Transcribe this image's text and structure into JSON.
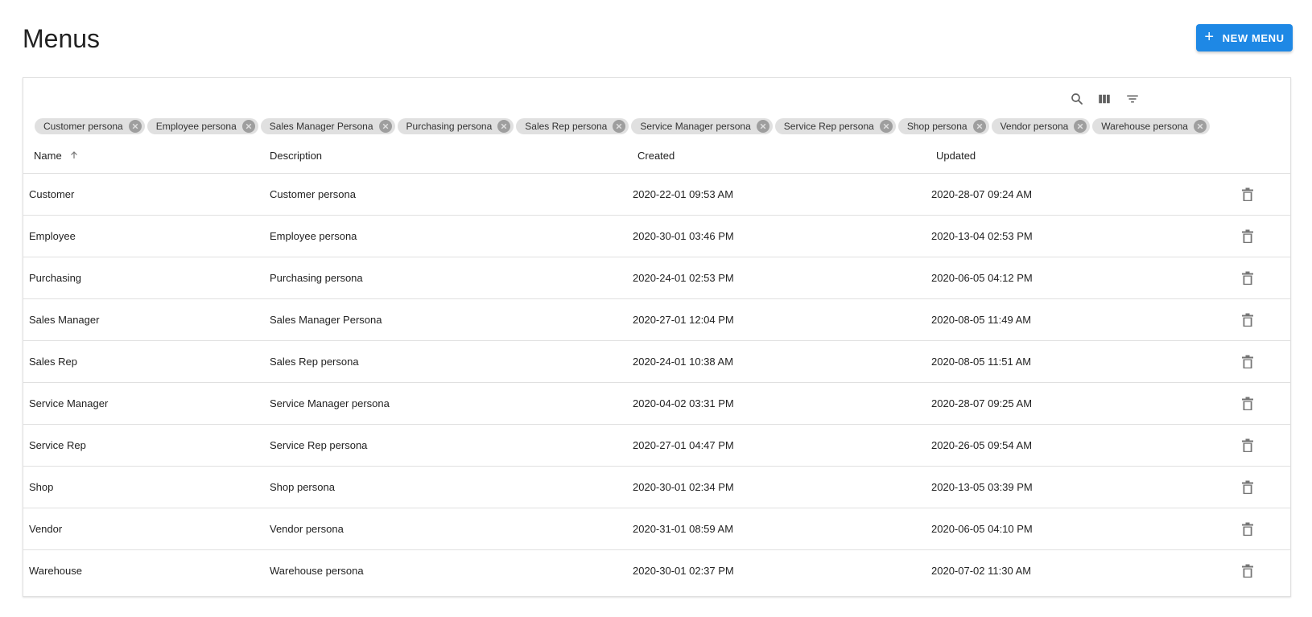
{
  "page": {
    "title": "Menus",
    "new_button_label": "NEW MENU"
  },
  "toolbar": {
    "icons": [
      "search-icon",
      "view-column-icon",
      "filter-list-icon"
    ]
  },
  "filter_chips": [
    "Customer persona",
    "Employee persona",
    "Sales Manager Persona",
    "Purchasing persona",
    "Sales Rep persona",
    "Service Manager persona",
    "Service Rep persona",
    "Shop persona",
    "Vendor persona",
    "Warehouse persona"
  ],
  "table": {
    "columns": {
      "name": "Name",
      "description": "Description",
      "created": "Created",
      "updated": "Updated"
    },
    "sort": {
      "column": "name",
      "direction": "asc"
    },
    "rows": [
      {
        "name": "Customer",
        "description": "Customer persona",
        "created": "2020-22-01 09:53 AM",
        "updated": "2020-28-07 09:24 AM"
      },
      {
        "name": "Employee",
        "description": "Employee persona",
        "created": "2020-30-01 03:46 PM",
        "updated": "2020-13-04 02:53 PM"
      },
      {
        "name": "Purchasing",
        "description": "Purchasing persona",
        "created": "2020-24-01 02:53 PM",
        "updated": "2020-06-05 04:12 PM"
      },
      {
        "name": "Sales Manager",
        "description": "Sales Manager Persona",
        "created": "2020-27-01 12:04 PM",
        "updated": "2020-08-05 11:49 AM"
      },
      {
        "name": "Sales Rep",
        "description": "Sales Rep persona",
        "created": "2020-24-01 10:38 AM",
        "updated": "2020-08-05 11:51 AM"
      },
      {
        "name": "Service Manager",
        "description": "Service Manager persona",
        "created": "2020-04-02 03:31 PM",
        "updated": "2020-28-07 09:25 AM"
      },
      {
        "name": "Service Rep",
        "description": "Service Rep persona",
        "created": "2020-27-01 04:47 PM",
        "updated": "2020-26-05 09:54 AM"
      },
      {
        "name": "Shop",
        "description": "Shop persona",
        "created": "2020-30-01 02:34 PM",
        "updated": "2020-13-05 03:39 PM"
      },
      {
        "name": "Vendor",
        "description": "Vendor persona",
        "created": "2020-31-01 08:59 AM",
        "updated": "2020-06-05 04:10 PM"
      },
      {
        "name": "Warehouse",
        "description": "Warehouse persona",
        "created": "2020-30-01 02:37 PM",
        "updated": "2020-07-02 11:30 AM"
      }
    ]
  },
  "colors": {
    "accent": "#1e88e5",
    "chip_bg": "#e0e0e0",
    "icon": "#757575"
  }
}
